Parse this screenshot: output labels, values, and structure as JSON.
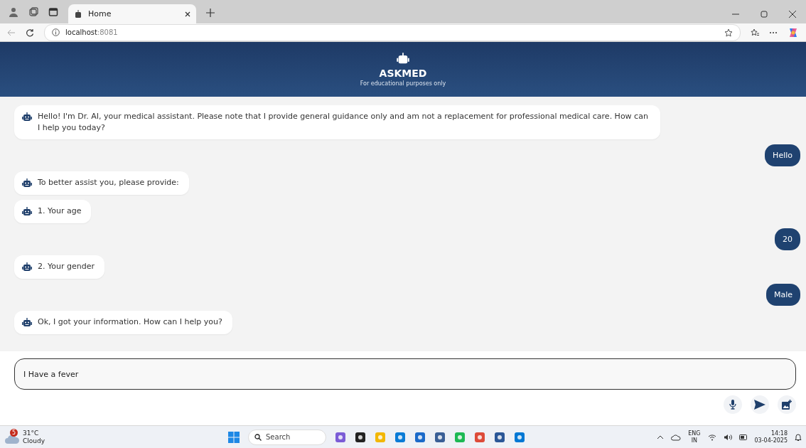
{
  "browser": {
    "tab": {
      "title": "Home",
      "selected": true
    },
    "address": "localhost",
    "port": ":8081"
  },
  "header": {
    "title": "ASKMED",
    "subtitle": "For educational purposes only"
  },
  "messages": [
    {
      "kind": "bot",
      "text": "Hello! I'm Dr. AI, your medical assistant. Please note that I provide general guidance only and am not a replacement for professional medical care. How can I help you today?"
    },
    {
      "kind": "user",
      "text": "Hello"
    },
    {
      "kind": "bot",
      "text": "To better assist you, please provide:"
    },
    {
      "kind": "bot",
      "text": "1. Your age"
    },
    {
      "kind": "user",
      "text": "20"
    },
    {
      "kind": "bot",
      "text": "2. Your gender"
    },
    {
      "kind": "user",
      "text": "Male"
    },
    {
      "kind": "bot",
      "text": "Ok, I got your information. How can I help you?"
    }
  ],
  "input": {
    "value": "I Have a fever"
  },
  "taskbar": {
    "weather_badge": "5",
    "temperature": "31°C",
    "condition": "Cloudy",
    "search_placeholder": "Search",
    "language": "ENG",
    "region": "IN",
    "time": "14:18",
    "date": "03-04-2025"
  }
}
